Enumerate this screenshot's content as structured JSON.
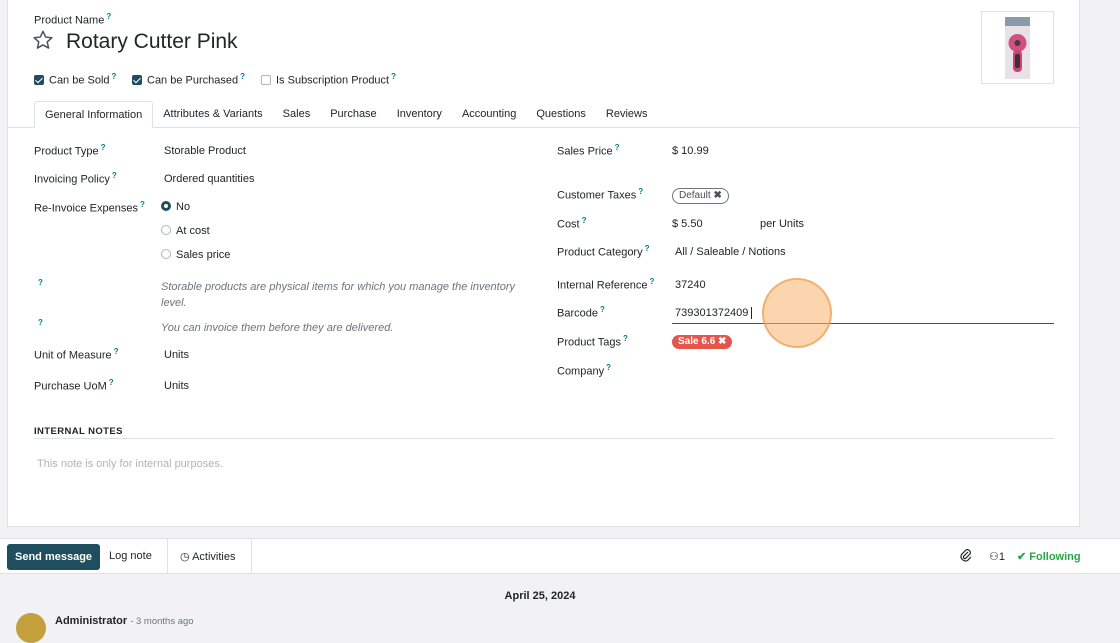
{
  "header": {
    "product_name_label": "Product Name",
    "product_name": "Rotary Cutter Pink",
    "checkboxes": [
      {
        "label": "Can be Sold",
        "checked": true
      },
      {
        "label": "Can be Purchased",
        "checked": true
      },
      {
        "label": "Is Subscription Product",
        "checked": false
      }
    ]
  },
  "tabs": [
    "General Information",
    "Attributes & Variants",
    "Sales",
    "Purchase",
    "Inventory",
    "Accounting",
    "Questions",
    "Reviews"
  ],
  "left": {
    "product_type_label": "Product Type",
    "product_type": "Storable Product",
    "invoicing_policy_label": "Invoicing Policy",
    "invoicing_policy": "Ordered quantities",
    "reinvoice_label": "Re-Invoice Expenses",
    "reinvoice_options": [
      "No",
      "At cost",
      "Sales price"
    ],
    "help_1": "Storable products are physical items for which you manage the inventory level.",
    "help_2": "You can invoice them before they are delivered.",
    "uom_label": "Unit of Measure",
    "uom": "Units",
    "purchase_uom_label": "Purchase UoM",
    "purchase_uom": "Units"
  },
  "right": {
    "sales_price_label": "Sales Price",
    "sales_price": "$ 10.99",
    "customer_taxes_label": "Customer Taxes",
    "customer_tax_badge": "Default",
    "cost_label": "Cost",
    "cost": "$ 5.50",
    "cost_unit": "per Units",
    "category_label": "Product Category",
    "category": "All / Saleable / Notions",
    "internal_ref_label": "Internal Reference",
    "internal_ref": "37240",
    "barcode_label": "Barcode",
    "barcode": "739301372409",
    "tags_label": "Product Tags",
    "tag": "Sale 6.6",
    "company_label": "Company"
  },
  "notes": {
    "title": "INTERNAL NOTES",
    "placeholder": "This note is only for internal purposes."
  },
  "chatter": {
    "send_message": "Send message",
    "log_note": "Log note",
    "activities": "Activities",
    "followers_count": "1",
    "following": "Following",
    "date": "April 25, 2024",
    "author": "Administrator",
    "time": "- 3 months ago"
  },
  "colors": {
    "primary": "#1f4e5f",
    "tag_red": "#e4554b",
    "following_green": "#28a745",
    "cursor_highlight": "#f7b26a"
  }
}
